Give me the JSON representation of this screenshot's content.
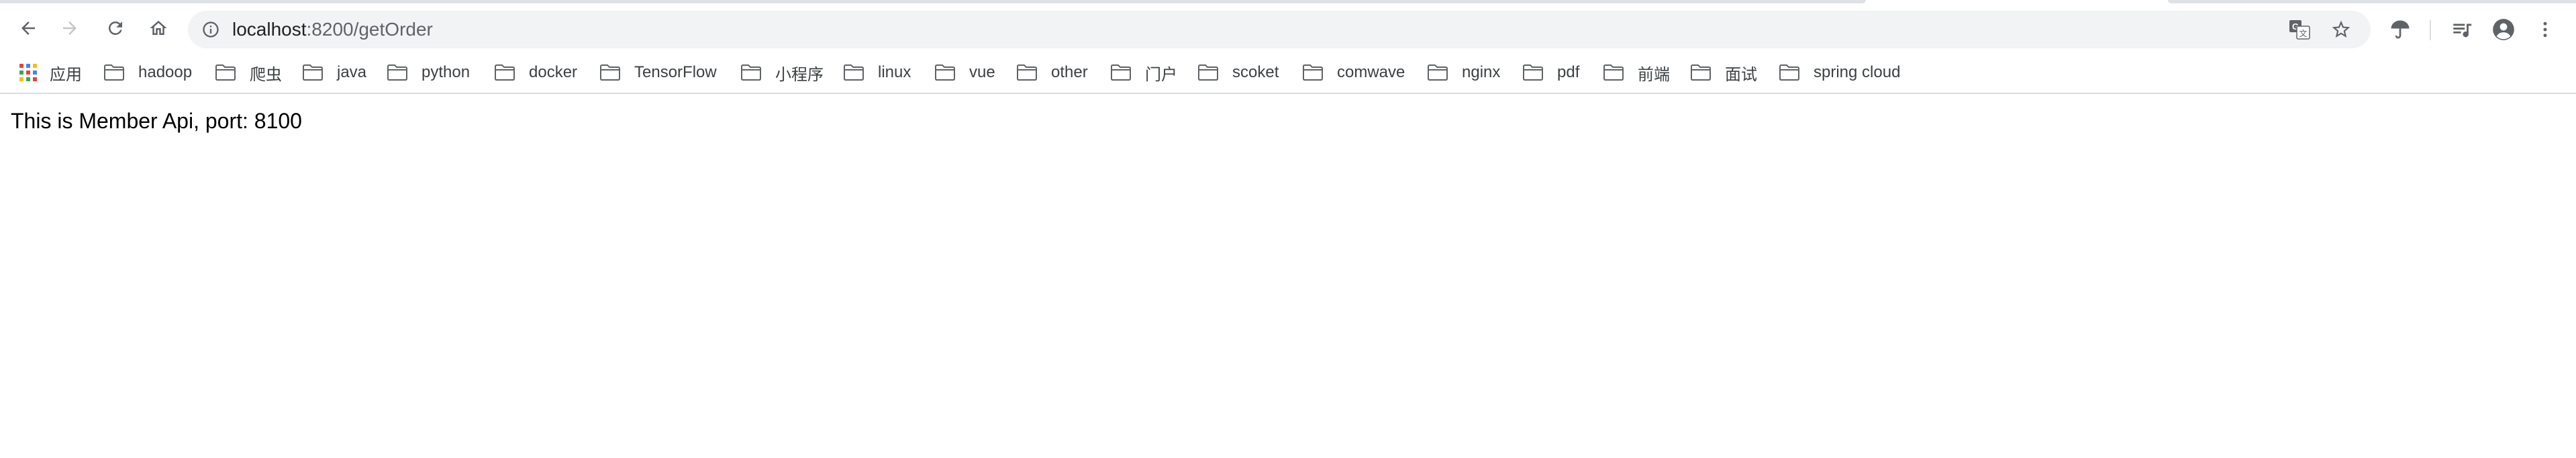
{
  "browser": {
    "address_host": "localhost",
    "address_path": ":8200/getOrder",
    "icons": {
      "back": "arrow-left-icon",
      "forward": "arrow-right-icon",
      "reload": "reload-icon",
      "home": "home-icon",
      "info": "info-icon",
      "translate": "translate-icon",
      "star": "star-icon",
      "umbrella": "umbrella-extension-icon",
      "media": "media-queue-icon",
      "profile": "profile-icon",
      "menu": "kebab-menu-icon"
    },
    "colors": {
      "toolbar_bg": "#ffffff",
      "omnibox_bg": "#f1f3f4",
      "icon": "#5f6368",
      "icon_disabled": "#c4c7c5",
      "text": "#202124"
    }
  },
  "bookmarks": {
    "apps_label": "应用",
    "folders": [
      {
        "label": "hadoop"
      },
      {
        "label": "爬虫"
      },
      {
        "label": "java"
      },
      {
        "label": "python"
      },
      {
        "label": "docker"
      },
      {
        "label": "TensorFlow"
      },
      {
        "label": "小程序"
      },
      {
        "label": "linux"
      },
      {
        "label": "vue"
      },
      {
        "label": "other"
      },
      {
        "label": "门户"
      },
      {
        "label": "scoket"
      },
      {
        "label": "comwave"
      },
      {
        "label": "nginx"
      },
      {
        "label": "pdf"
      },
      {
        "label": "前端"
      },
      {
        "label": "面试"
      },
      {
        "label": "spring cloud"
      }
    ]
  },
  "page": {
    "message": "This is Member Api, port: 8100"
  }
}
